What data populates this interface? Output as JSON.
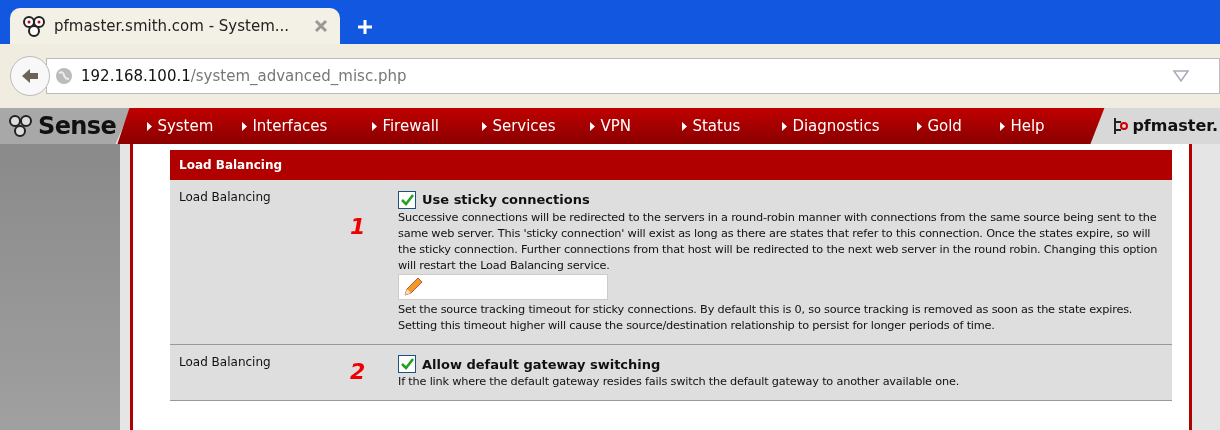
{
  "browser": {
    "tab": {
      "title": "pfmaster.smith.com - System..."
    },
    "address": {
      "host": "192.168.100.1",
      "path": "/system_advanced_misc.php"
    }
  },
  "navbar": {
    "logo": "Sense",
    "items": [
      "System",
      "Interfaces",
      "Firewall",
      "Services",
      "VPN",
      "Status",
      "Diagnostics",
      "Gold",
      "Help"
    ],
    "hostname": "pfmaster."
  },
  "section": {
    "title": "Load Balancing"
  },
  "rows": [
    {
      "label": "Load Balancing",
      "marker": "1",
      "checked": true,
      "option": "Use sticky connections",
      "description": "Successive connections will be redirected to the servers in a round-robin manner with connections from the same source being sent to the same web server. This 'sticky connection' will exist as long as there are states that refer to this connection. Once the states expire, so will the sticky connection. Further connections from that host will be redirected to the next web server in the round robin. Changing this option will restart the Load Balancing service.",
      "field": {
        "help": "Set the source tracking timeout for sticky connections. By default this is 0, so source tracking is removed as soon as the state expires. Setting this timeout higher will cause the source/destination relationship to persist for longer periods of time."
      }
    },
    {
      "label": "Load Balancing",
      "marker": "2",
      "checked": true,
      "option": "Allow default gateway switching",
      "description": "If the link where the default gateway resides fails switch the default gateway to another available one."
    }
  ]
}
